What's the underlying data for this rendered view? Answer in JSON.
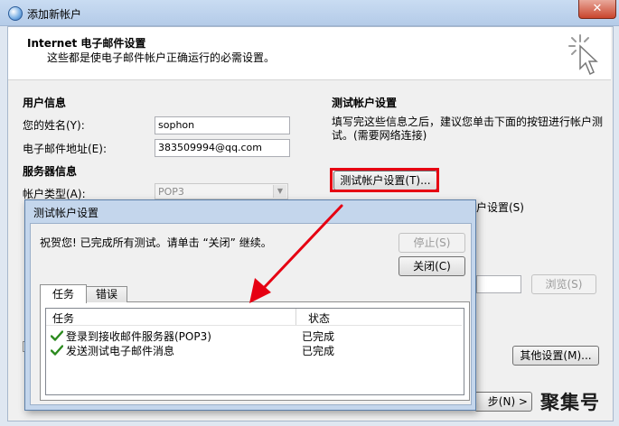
{
  "main_window": {
    "title": "添加新帐户",
    "header_title": "Internet 电子邮件设置",
    "header_subtitle": "这些都是使电子邮件帐户正确运行的必需设置。"
  },
  "user_info": {
    "section_title": "用户信息",
    "name_label": "您的姓名(Y):",
    "name_value": "sophon",
    "email_label": "电子邮件地址(E):",
    "email_value": "383509994@qq.com"
  },
  "server_info": {
    "section_title": "服务器信息",
    "account_type_label": "帐户类型(A):",
    "account_type_value": "POP3"
  },
  "test_settings": {
    "section_title": "测试帐户设置",
    "description": "填写完这些信息之后，建议您单击下面的按钮进行帐户测试。(需要网络连接)",
    "test_button_label": "测试帐户设置(T)...",
    "partial_option": "户设置(S)",
    "browse_button_label": "浏览(S)",
    "more_settings_button_label": "其他设置(M)...",
    "next_button_label": "步(N) >"
  },
  "dialog": {
    "title": "测试帐户设置",
    "message": "祝贺您! 已完成所有测试。请单击 “关闭” 继续。",
    "stop_button_label": "停止(S)",
    "close_button_label": "关闭(C)",
    "tabs": [
      "任务",
      "错误"
    ],
    "columns": [
      "任务",
      "状态"
    ],
    "tasks": [
      {
        "name": "登录到接收邮件服务器(POP3)",
        "status": "已完成"
      },
      {
        "name": "发送测试电子邮件消息",
        "status": "已完成"
      }
    ]
  },
  "watermark": "聚集号",
  "colors": {
    "highlight_red": "#e60012",
    "check_green": "#2b8a1e",
    "title_bar": "#c9dcf2"
  }
}
